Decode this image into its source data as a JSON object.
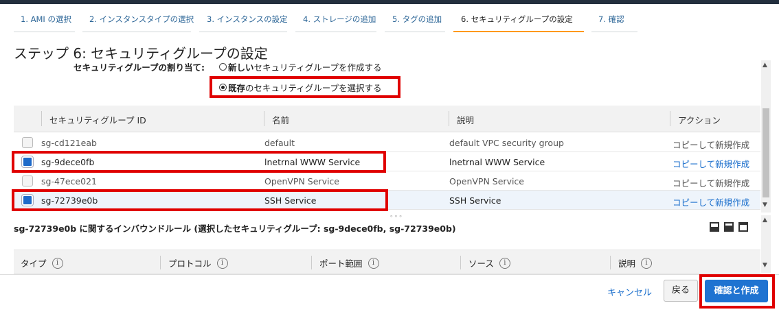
{
  "tabs": [
    {
      "label": "1. AMI の選択"
    },
    {
      "label": "2. インスタンスタイプの選択"
    },
    {
      "label": "3. インスタンスの設定"
    },
    {
      "label": "4. ストレージの追加"
    },
    {
      "label": "5. タグの追加"
    },
    {
      "label": "6. セキュリティグループの設定"
    },
    {
      "label": "7. 確認"
    }
  ],
  "step_title": "ステップ 6: セキュリティグループの設定",
  "assign": {
    "label": "セキュリティグループの割り当て:",
    "new_bold": "新しい",
    "new_rest": "セキュリティグループを作成する",
    "existing_bold": "既存",
    "existing_rest": "のセキュリティグループを選択する"
  },
  "table": {
    "headers": [
      "セキュリティグループ ID",
      "名前",
      "説明",
      "アクション"
    ],
    "rows": [
      {
        "id": "sg-cd121eab",
        "name": "default",
        "desc": "default VPC security group",
        "action": "コピーして新規作成",
        "checked": false
      },
      {
        "id": "sg-9dece0fb",
        "name": "lnetrnal WWW Service",
        "desc": "lnetrnal WWW Service",
        "action": "コピーして新規作成",
        "checked": true
      },
      {
        "id": "sg-47ece021",
        "name": "OpenVPN Service",
        "desc": "OpenVPN Service",
        "action": "コピーして新規作成",
        "checked": false
      },
      {
        "id": "sg-72739e0b",
        "name": "SSH Service",
        "desc": "SSH Service",
        "action": "コピーして新規作成",
        "checked": true
      }
    ]
  },
  "inbound": {
    "title": "sg-72739e0b に関するインバウンドルール (選択したセキュリティグループ: sg-9dece0fb, sg-72739e0b)",
    "headers": [
      "タイプ",
      "プロトコル",
      "ポート範囲",
      "ソース",
      "説明"
    ],
    "info_glyph": "i"
  },
  "buttons": {
    "cancel": "キャンセル",
    "back": "戻る",
    "review_launch": "確認と作成"
  },
  "colors": {
    "accent_tab": "#ff9900",
    "link": "#1a6ecc",
    "primary_button": "#1f73d1",
    "highlight_box": "#e00000"
  }
}
